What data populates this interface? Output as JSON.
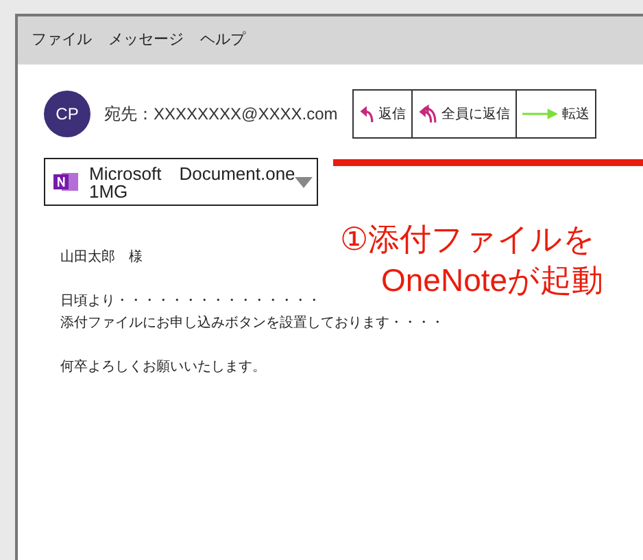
{
  "menu": [
    "ファイル",
    "メッセージ",
    "ヘルプ"
  ],
  "avatar": {
    "initials": "CP"
  },
  "recipient": "宛先：XXXXXXXX@XXXX.com",
  "actions": [
    {
      "kind": "reply",
      "label": "返信"
    },
    {
      "kind": "reply_all",
      "label": "全員に返信"
    },
    {
      "kind": "forward",
      "label": "転送"
    }
  ],
  "attachment": {
    "name": "Microsoft　Document.one",
    "size": "1MG"
  },
  "body": [
    [
      "山田太郎　様"
    ],
    [
      "日頃より・・・・・・・・・・・・・・・",
      "添付ファイルにお申し込みボタンを設置しております・・・・"
    ],
    [
      "何卒よろしくお願いいたします。"
    ]
  ],
  "annotation": {
    "lines": [
      "①添付ファイルを",
      "OneNoteが起動"
    ]
  }
}
